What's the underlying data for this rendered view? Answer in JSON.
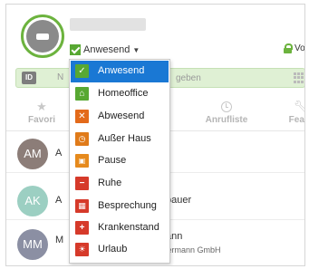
{
  "header": {
    "status_label": "Anwesend",
    "lock_text": "Vo"
  },
  "search": {
    "badge": "ID",
    "visible_left": "N",
    "placeholder": "geben"
  },
  "tabs": [
    {
      "label": "Favori",
      "icon": "star-icon"
    },
    {
      "label": "Anrufliste",
      "icon": "clock-icon"
    },
    {
      "label": "Featu",
      "icon": "wrench-icon"
    }
  ],
  "contacts": [
    {
      "initials": "AM",
      "color": "#8c7d78",
      "peek": "A",
      "line1": "",
      "line2": ""
    },
    {
      "initials": "AK",
      "color": "#9ccfc2",
      "peek": "A",
      "line1": "bauer",
      "line2": ""
    },
    {
      "initials": "MM",
      "color": "#8b8fa3",
      "peek": "M",
      "line1": "ann",
      "line2": "Mustermann GmbH"
    }
  ],
  "status_menu": {
    "selected_index": 0,
    "items": [
      {
        "label": "Anwesend",
        "icon": "check-icon",
        "color": "#58a832"
      },
      {
        "label": "Homeoffice",
        "icon": "home-icon",
        "color": "#58a832"
      },
      {
        "label": "Abwesend",
        "icon": "x-icon",
        "color": "#e36a1a"
      },
      {
        "label": "Außer Haus",
        "icon": "clock-out-icon",
        "color": "#e07b1a"
      },
      {
        "label": "Pause",
        "icon": "coffee-icon",
        "color": "#e68a1d"
      },
      {
        "label": "Ruhe",
        "icon": "minus-icon",
        "color": "#d63a2a"
      },
      {
        "label": "Besprechung",
        "icon": "calendar-icon",
        "color": "#d63a2a"
      },
      {
        "label": "Krankenstand",
        "icon": "medical-icon",
        "color": "#d63a2a"
      },
      {
        "label": "Urlaub",
        "icon": "sun-icon",
        "color": "#d63a2a"
      }
    ]
  }
}
